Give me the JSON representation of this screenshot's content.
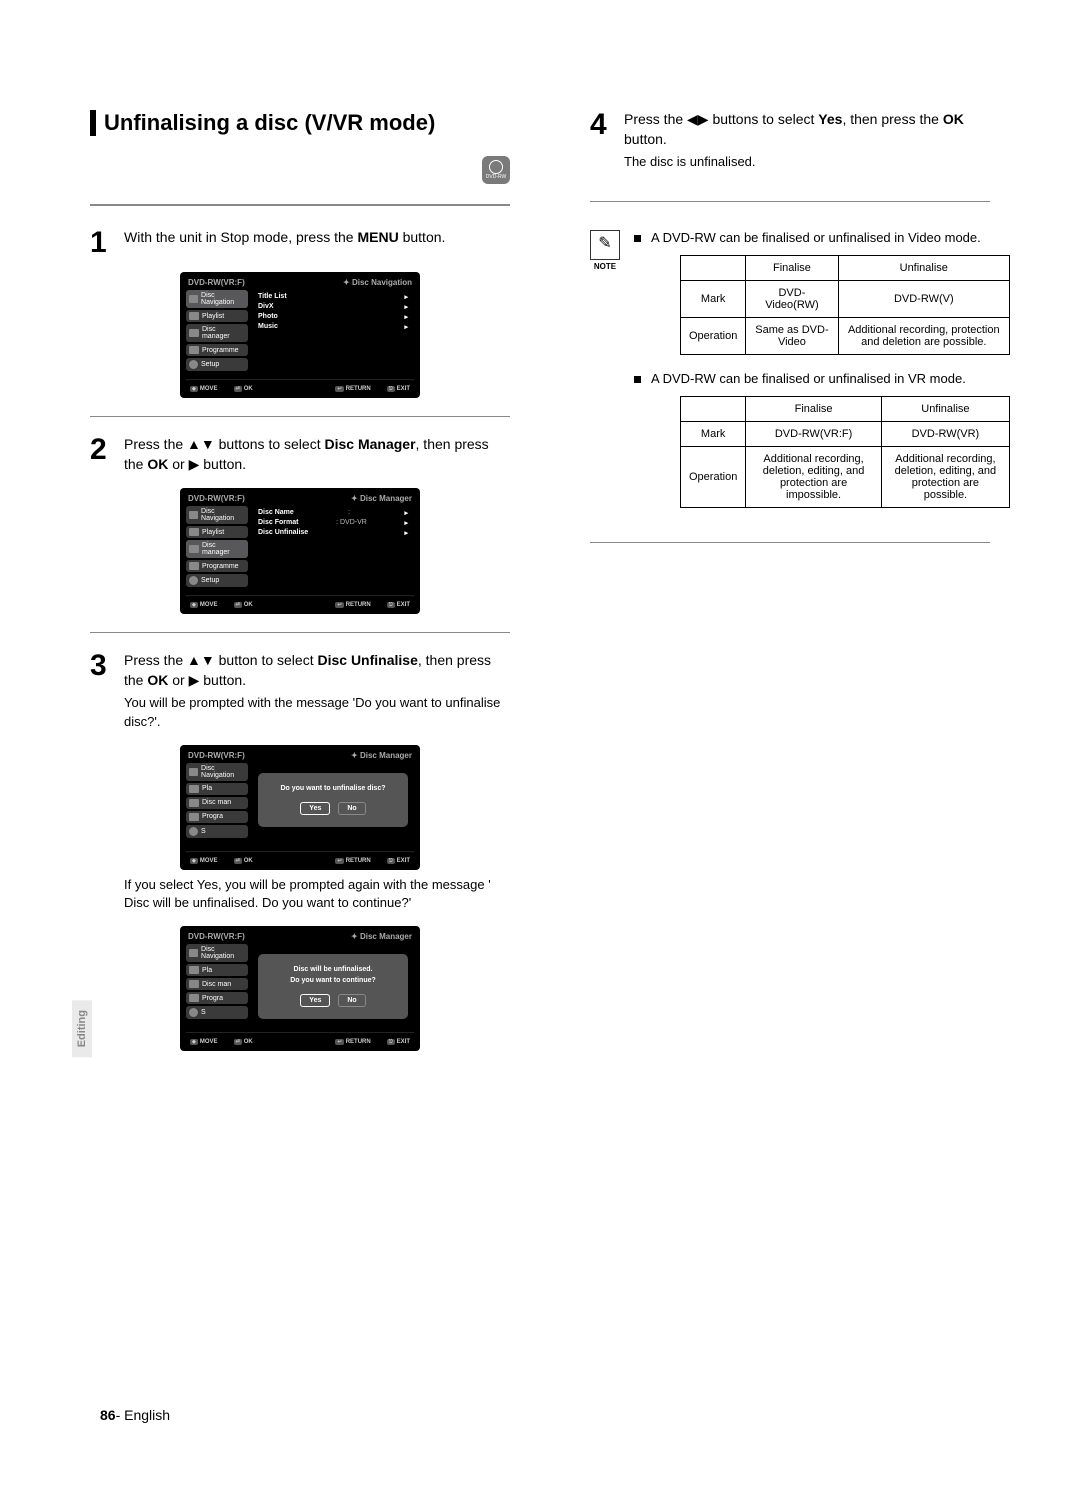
{
  "section_title": "Unfinalising a disc (V/VR mode)",
  "disc_badge": "DVD-RW",
  "steps": {
    "s1": {
      "num": "1",
      "text_pre": "With the unit in Stop mode, press the ",
      "text_bold": "MENU",
      "text_post": " button."
    },
    "s2": {
      "num": "2",
      "text_pre": "Press the ▲▼ buttons to select ",
      "text_bold1": "Disc Manager",
      "text_mid": ", then press the ",
      "text_bold2": "OK",
      "text_post": " or ▶ button."
    },
    "s3": {
      "num": "3",
      "text_pre": "Press the ▲▼ button to select ",
      "text_bold1": "Disc Unfinalise",
      "text_mid": ", then press the ",
      "text_bold2": "OK",
      "text_post": " or ▶ button.",
      "sub": "You will be prompted with the message 'Do you want to unfinalise disc?'."
    },
    "s3_after": "If you select Yes, you will be prompted again with the message ' Disc will be unfinalised. Do you want to continue?'",
    "s4": {
      "num": "4",
      "text_pre": "Press the ◀▶ buttons to select ",
      "text_bold1": "Yes",
      "text_mid": ", then press the ",
      "text_bold2": "OK",
      "text_post": " button.",
      "sub": "The disc is unfinalised."
    }
  },
  "osd": {
    "model": "DVD-RW(VR:F)",
    "crumb_nav": "Disc Navigation",
    "crumb_mgr": "Disc Manager",
    "side": {
      "nav": "Disc Navigation",
      "playlist": "Playlist",
      "manager": "Disc manager",
      "programme": "Programme",
      "setup": "Setup",
      "pla": "Pla",
      "man": "Disc man",
      "progra": "Progra",
      "s": "S"
    },
    "list1": {
      "title": "Title List",
      "divx": "DivX",
      "photo": "Photo",
      "music": "Music"
    },
    "list2": {
      "name": "Disc Name",
      "name_val": ":",
      "format": "Disc Format",
      "format_val": ": DVD-VR",
      "unfinalise": "Disc Unfinalise"
    },
    "dialog1": "Do you want to unfinalise disc?",
    "dialog2a": "Disc will be unfinalised.",
    "dialog2b": "Do you want to continue?",
    "yes": "Yes",
    "no": "No",
    "btn_move": "MOVE",
    "btn_ok": "OK",
    "btn_return": "RETURN",
    "btn_exit": "EXIT"
  },
  "note": {
    "label": "NOTE",
    "bullet1": "A DVD-RW can be finalised or unfinalised in Video mode.",
    "bullet2": "A DVD-RW can be finalised or unfinalised in VR mode."
  },
  "table1": {
    "h_finalise": "Finalise",
    "h_unfinalise": "Unfinalise",
    "r_mark": "Mark",
    "r_mark_f": "DVD-Video(RW)",
    "r_mark_u": "DVD-RW(V)",
    "r_op": "Operation",
    "r_op_f": "Same as DVD-Video",
    "r_op_u": "Additional recording, protection and deletion are possible."
  },
  "table2": {
    "h_finalise": "Finalise",
    "h_unfinalise": "Unfinalise",
    "r_mark": "Mark",
    "r_mark_f": "DVD-RW(VR:F)",
    "r_mark_u": "DVD-RW(VR)",
    "r_op": "Operation",
    "r_op_f": "Additional recording, deletion, editing, and protection are impossible.",
    "r_op_u": "Additional recording, deletion, editing, and protection are possible."
  },
  "side_tab": "Editing",
  "footer": {
    "page": "86",
    "dash": "- ",
    "lang": "English"
  }
}
